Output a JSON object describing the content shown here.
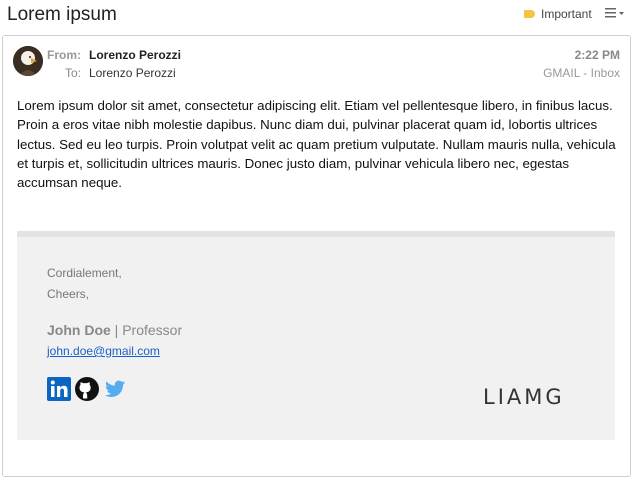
{
  "header": {
    "subject": "Lorem ipsum",
    "important_label": "Important",
    "important_color": "#f4c542"
  },
  "message": {
    "from_label": "From:",
    "from_name": "Lorenzo Perozzi",
    "to_label": "To:",
    "to_name": "Lorenzo Perozzi",
    "time": "2:22 PM",
    "folder": "GMAIL - Inbox",
    "body": "Lorem ipsum dolor sit amet, consectetur adipiscing elit. Etiam vel pellentesque libero, in finibus lacus. Proin a eros vitae nibh molestie dapibus. Nunc diam dui, pulvinar placerat quam id, lobortis ultrices lectus. Sed eu leo turpis. Proin volutpat velit ac quam pretium vulputate. Nullam mauris nulla, vehicula et turpis et, sollicitudin ultrices mauris. Donec justo diam, pulvinar vehicula libero nec, egestas accumsan neque."
  },
  "signature": {
    "line1": "Cordialement,",
    "line2": "Cheers,",
    "name": "John Doe",
    "separator": " | ",
    "title": "Professor",
    "email": "john.doe@gmail.com",
    "social_icons": [
      "linkedin-icon",
      "github-icon",
      "twitter-icon"
    ],
    "logo_text": "LIAMG",
    "background": "#f1f1f1"
  }
}
